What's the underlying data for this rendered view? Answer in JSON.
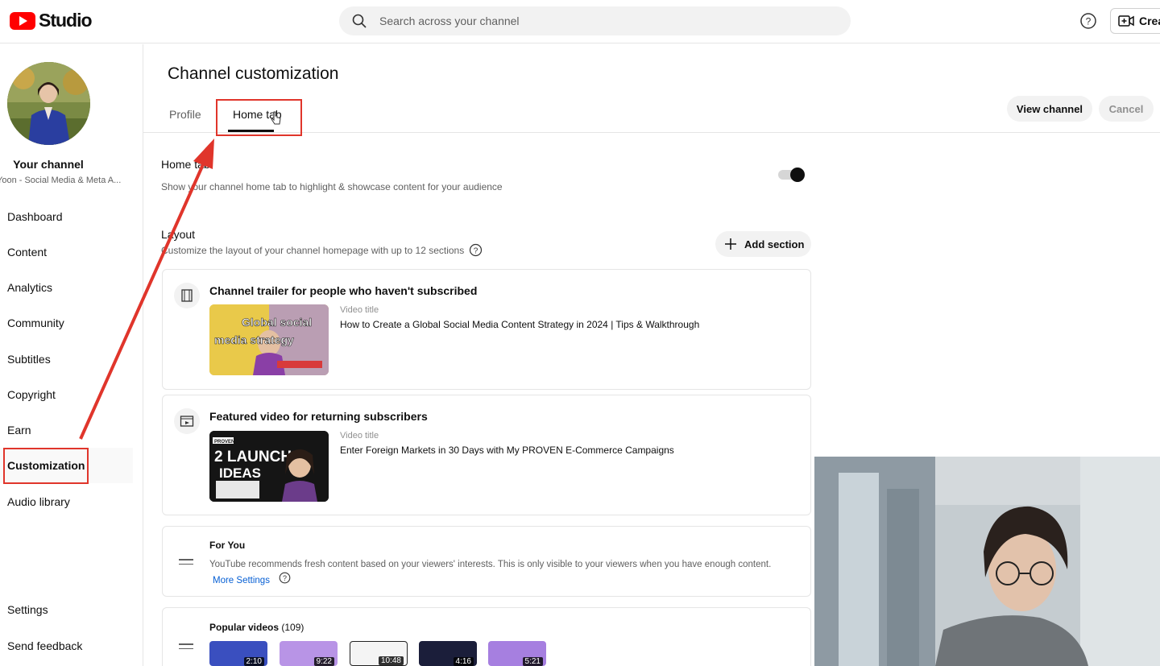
{
  "header": {
    "logo_text": "Studio",
    "search_placeholder": "Search across your channel",
    "create_label": "Crea"
  },
  "sidebar": {
    "channel_name": "Your channel",
    "channel_subtitle": "Yoon - Social Media & Meta A...",
    "items": [
      {
        "label": "Dashboard"
      },
      {
        "label": "Content"
      },
      {
        "label": "Analytics"
      },
      {
        "label": "Community"
      },
      {
        "label": "Subtitles"
      },
      {
        "label": "Copyright"
      },
      {
        "label": "Earn"
      },
      {
        "label": "Customization"
      },
      {
        "label": "Audio library"
      }
    ],
    "bottom_items": [
      {
        "label": "Settings"
      },
      {
        "label": "Send feedback"
      }
    ]
  },
  "main": {
    "title": "Channel customization",
    "tabs": [
      {
        "label": "Profile"
      },
      {
        "label": "Home tab"
      }
    ],
    "view_channel_label": "View channel",
    "cancel_label": "Cancel",
    "home_tab": {
      "label": "Home tab",
      "description": "Show your channel home tab to highlight & showcase content for your audience",
      "enabled": true
    },
    "layout": {
      "label": "Layout",
      "description": "Customize the layout of your channel homepage with up to 12 sections",
      "add_section_label": "Add section"
    },
    "sections": [
      {
        "title": "Channel trailer for people who haven't subscribed",
        "video_label": "Video title",
        "video_title": "How to Create a Global Social Media Content Strategy in 2024 | Tips & Walkthrough",
        "thumb_text": "Global social media strategy"
      },
      {
        "title": "Featured video for returning subscribers",
        "video_label": "Video title",
        "video_title": "Enter Foreign Markets in 30 Days with My PROVEN E-Commerce Campaigns",
        "thumb_text": "2 LAUNCH IDEAS",
        "thumb_tag": "PROVEN"
      },
      {
        "title": "For You",
        "description": "YouTube recommends fresh content based on your viewers' interests. This is only visible to your viewers when you have enough content.",
        "link_label": "More Settings"
      },
      {
        "title": "Popular videos",
        "count": "(109)",
        "durations": [
          "2:10",
          "9:22",
          "10:48",
          "4:16",
          "5:21"
        ]
      }
    ]
  },
  "colors": {
    "brand_red": "#ff0000",
    "annotation_red": "#e0352b",
    "link_blue": "#065fd4"
  }
}
